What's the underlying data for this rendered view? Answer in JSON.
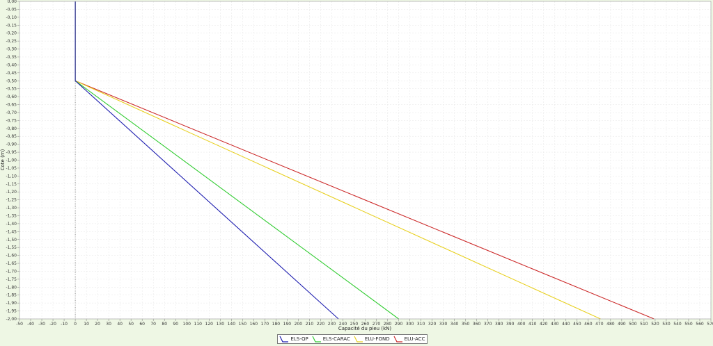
{
  "chart_data": {
    "type": "line",
    "xlabel": "Capacité du pieu (kN)",
    "ylabel": "Cote (m)",
    "xlim": [
      -50,
      570
    ],
    "ylim": [
      -2.0,
      0.0
    ],
    "x_tick_step": 10,
    "y_tick_step": 0.05,
    "grid": true,
    "legend_position": "bottom-center",
    "series": [
      {
        "name": "ELS-QP",
        "color": "#1f1fb0",
        "points": [
          [
            0,
            0.0
          ],
          [
            0,
            -0.5
          ],
          [
            236,
            -2.0
          ]
        ]
      },
      {
        "name": "ELS-CARAC",
        "color": "#33cc33",
        "points": [
          [
            0,
            0.0
          ],
          [
            0,
            -0.5
          ],
          [
            290,
            -2.0
          ]
        ]
      },
      {
        "name": "ELU-FOND",
        "color": "#e8d020",
        "points": [
          [
            0,
            0.0
          ],
          [
            0,
            -0.5
          ],
          [
            471,
            -2.0
          ]
        ]
      },
      {
        "name": "ELU-ACC",
        "color": "#cc2a2a",
        "points": [
          [
            0,
            0.0
          ],
          [
            0,
            -0.5
          ],
          [
            519,
            -2.0
          ]
        ]
      }
    ]
  }
}
